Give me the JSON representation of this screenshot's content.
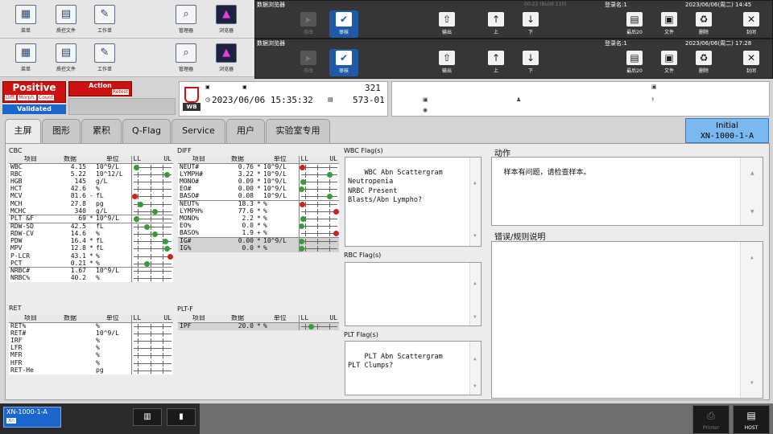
{
  "toolbar": {
    "menu": "菜单",
    "qc_file": "质控文件",
    "worklist": "工作单",
    "manager": "管理器",
    "browser": "浏览器"
  },
  "browser_bar1": {
    "title": "数据浏览器",
    "build": "00-22 (Build 110)",
    "login": "登录名:1",
    "datetime": "2023/06/06(周二) 14:45",
    "buttons": [
      "修改",
      "审核",
      "输出",
      "上",
      "下",
      "最后20",
      "文件",
      "删除",
      "封闭"
    ]
  },
  "browser_bar2": {
    "title": "数据浏览器",
    "login": "登录名:1",
    "datetime": "2023/06/06(周二) 17:28",
    "buttons": [
      "修改",
      "审核",
      "输出",
      "上",
      "下",
      "最后20",
      "文件",
      "删除",
      "封闭"
    ]
  },
  "status": {
    "positive": "Positive",
    "diff": "Diff.",
    "morph": "Morph.",
    "count": "Count",
    "action": "Action",
    "retest": "Retest",
    "validated": "Validated"
  },
  "sample": {
    "wb": "WB",
    "rack": "321",
    "datetime": "2023/06/06 15:35:32",
    "tube": "573-01"
  },
  "tabs": [
    "主屏",
    "图形",
    "累积",
    "Q-Flag",
    "Service",
    "用户",
    "实验室专用"
  ],
  "initial": {
    "line1": "Initial",
    "line2": "XN-1000-1-A"
  },
  "headers": {
    "item": "项目",
    "data": "数据",
    "unit": "单位",
    "ll": "LL",
    "ul": "UL"
  },
  "sections": {
    "cbc": "CBC",
    "diff": "DIFF",
    "ret": "RET",
    "pltf": "PLT-F",
    "wbc_flag": "WBC Flag(s)",
    "rbc_flag": "RBC Flag(s)",
    "plt_flag": "PLT Flag(s)",
    "action": "动作",
    "error": "错误/规则说明"
  },
  "colors": {
    "green": "#3a9a3a",
    "red": "#cc2222",
    "positive": "#cc1111",
    "validated": "#1a66cc"
  },
  "cbc": [
    {
      "name": "WBC",
      "value": "4.15",
      "flag": "",
      "unit": "10^9/L",
      "mark": "green",
      "pos": 0.1
    },
    {
      "name": "RBC",
      "value": "5.22",
      "flag": "",
      "unit": "10^12/L",
      "mark": "green",
      "pos": 0.85
    },
    {
      "name": "HGB",
      "value": "145",
      "flag": "",
      "unit": "g/L",
      "mark": "",
      "pos": 0
    },
    {
      "name": "HCT",
      "value": "42.6",
      "flag": "",
      "unit": "%",
      "mark": "",
      "pos": 0
    },
    {
      "name": "MCV",
      "value": "81.6",
      "flag": "-",
      "unit": "fL",
      "mark": "red",
      "pos": 0.0
    },
    {
      "name": "MCH",
      "value": "27.8",
      "flag": "",
      "unit": "pg",
      "mark": "green",
      "pos": 0.2
    },
    {
      "name": "MCHC",
      "value": "340",
      "flag": "",
      "unit": "g/L",
      "mark": "green",
      "pos": 0.55
    },
    {
      "name": "PLT &F",
      "value": "69",
      "flag": "*",
      "unit": "10^9/L",
      "mark": "green",
      "pos": 0.1
    },
    {
      "name": "RDW-SD",
      "value": "42.5",
      "flag": "",
      "unit": "fL",
      "mark": "green",
      "pos": 0.35
    },
    {
      "name": "RDW-CV",
      "value": "14.6",
      "flag": "",
      "unit": "%",
      "mark": "green",
      "pos": 0.55
    },
    {
      "name": "PDW",
      "value": "16.4",
      "flag": "*",
      "unit": "fL",
      "mark": "green",
      "pos": 0.8
    },
    {
      "name": "MPV",
      "value": "12.8",
      "flag": "*",
      "unit": "fL",
      "mark": "green",
      "pos": 0.85
    },
    {
      "name": "P-LCR",
      "value": "43.1",
      "flag": "*",
      "unit": "%",
      "mark": "red",
      "pos": 0.98
    },
    {
      "name": "PCT",
      "value": "0.21",
      "flag": "*",
      "unit": "%",
      "mark": "green",
      "pos": 0.35
    },
    {
      "name": "NRBC#",
      "value": "1.67",
      "flag": "",
      "unit": "10^9/L",
      "mark": "",
      "pos": 0
    },
    {
      "name": "NRBC%",
      "value": "40.2",
      "flag": "",
      "unit": "%",
      "mark": "",
      "pos": 0
    }
  ],
  "diff": [
    {
      "name": "NEUT#",
      "value": "0.76",
      "flag": "*",
      "unit": "10^9/L",
      "mark": "red",
      "pos": 0.0
    },
    {
      "name": "LYMPH#",
      "value": "3.22",
      "flag": "*",
      "unit": "10^9/L",
      "mark": "green",
      "pos": 0.75
    },
    {
      "name": "MONO#",
      "value": "0.09",
      "flag": "*",
      "unit": "10^9/L",
      "mark": "green",
      "pos": 0.1
    },
    {
      "name": "EO#",
      "value": "0.00",
      "flag": "*",
      "unit": "10^9/L",
      "mark": "green",
      "pos": 0.05
    },
    {
      "name": "BASO#",
      "value": "0.08",
      "flag": "",
      "unit": "10^9/L",
      "mark": "green",
      "pos": 0.75
    },
    {
      "name": "NEUT%",
      "value": "18.3",
      "flag": "*",
      "unit": "%",
      "mark": "red",
      "pos": 0.0
    },
    {
      "name": "LYMPH%",
      "value": "77.6",
      "flag": "*",
      "unit": "%",
      "mark": "red",
      "pos": 0.98
    },
    {
      "name": "MONO%",
      "value": "2.2",
      "flag": "*",
      "unit": "%",
      "mark": "green",
      "pos": 0.1
    },
    {
      "name": "EO%",
      "value": "0.0",
      "flag": "*",
      "unit": "%",
      "mark": "green",
      "pos": 0.05
    },
    {
      "name": "BASO%",
      "value": "1.9",
      "flag": "+",
      "unit": "%",
      "mark": "red",
      "pos": 0.98
    },
    {
      "name": "IG#",
      "value": "0.00",
      "flag": "*",
      "unit": "10^9/L",
      "mark": "green",
      "pos": 0.05
    },
    {
      "name": "IG%",
      "value": "0.0",
      "flag": "*",
      "unit": "%",
      "mark": "green",
      "pos": 0.05
    }
  ],
  "ret": [
    {
      "name": "RET%",
      "value": "",
      "flag": "",
      "unit": "%"
    },
    {
      "name": "RET#",
      "value": "",
      "flag": "",
      "unit": "10^9/L"
    },
    {
      "name": "IRF",
      "value": "",
      "flag": "",
      "unit": "%"
    },
    {
      "name": "LFR",
      "value": "",
      "flag": "",
      "unit": "%"
    },
    {
      "name": "MFR",
      "value": "",
      "flag": "",
      "unit": "%"
    },
    {
      "name": "HFR",
      "value": "",
      "flag": "",
      "unit": "%"
    },
    {
      "name": "RET-He",
      "value": "",
      "flag": "",
      "unit": "pg"
    }
  ],
  "pltf": [
    {
      "name": "IPF",
      "value": "20.0",
      "flag": "*",
      "unit": "%",
      "mark": "green",
      "pos": 0.3
    }
  ],
  "wbc_flags": "WBC Abn Scattergram\nNeutropenia\nNRBC Present\nBlasts/Abn Lympho?",
  "rbc_flags": "",
  "plt_flags": "PLT Abn Scattergram\nPLT Clumps?",
  "action_text": "样本有问题，请检查样本。",
  "error_text": "",
  "bottom": {
    "instrument": "XN-1000-1-A",
    "xn": "Xn",
    "printer": "Printer",
    "host": "HOST"
  }
}
